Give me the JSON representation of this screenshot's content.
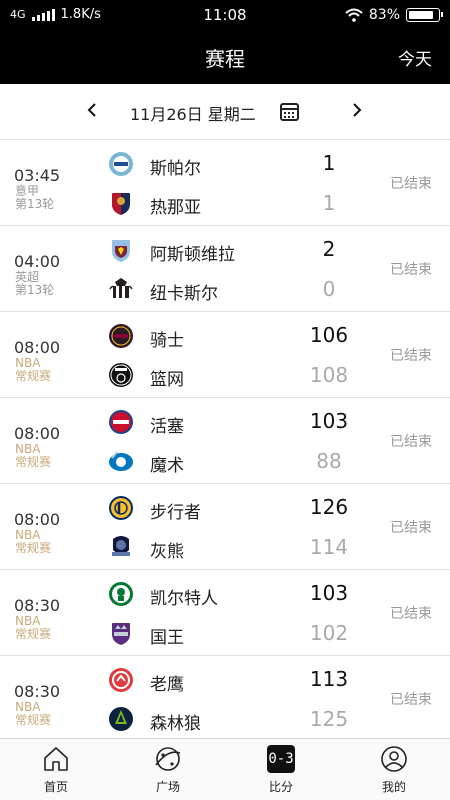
{
  "status": {
    "network": "4G",
    "speed": "1.8K/s",
    "time": "11:08",
    "battery": "83%"
  },
  "header": {
    "title": "赛程",
    "today": "今天"
  },
  "date_bar": {
    "date": "11月26日 星期二"
  },
  "matches": [
    {
      "time": "03:45",
      "league": "意甲",
      "round": "第13轮",
      "home": {
        "name": "斯帕尔",
        "score": "1",
        "logo": "spal-logo",
        "color": "#7ab5d8"
      },
      "away": {
        "name": "热那亚",
        "score": "1",
        "logo": "genoa-logo",
        "color": "#b5162b"
      },
      "status": "已结束"
    },
    {
      "time": "04:00",
      "league": "英超",
      "round": "第13轮",
      "home": {
        "name": "阿斯顿维拉",
        "score": "2",
        "logo": "aston-villa-logo",
        "color": "#95bfe5"
      },
      "away": {
        "name": "纽卡斯尔",
        "score": "0",
        "logo": "newcastle-logo",
        "color": "#241f20"
      },
      "status": "已结束"
    },
    {
      "time": "08:00",
      "league": "NBA",
      "round": "常规赛",
      "home": {
        "name": "骑士",
        "score": "106",
        "logo": "cavaliers-logo",
        "color": "#2b1b22"
      },
      "away": {
        "name": "篮网",
        "score": "108",
        "logo": "nets-logo",
        "color": "#111111"
      },
      "status": "已结束"
    },
    {
      "time": "08:00",
      "league": "NBA",
      "round": "常规赛",
      "home": {
        "name": "活塞",
        "score": "103",
        "logo": "pistons-logo",
        "color": "#c8102e"
      },
      "away": {
        "name": "魔术",
        "score": "88",
        "logo": "magic-logo",
        "color": "#0077c0"
      },
      "status": "已结束"
    },
    {
      "time": "08:00",
      "league": "NBA",
      "round": "常规赛",
      "home": {
        "name": "步行者",
        "score": "126",
        "logo": "pacers-logo",
        "color": "#fdbb30"
      },
      "away": {
        "name": "灰熊",
        "score": "114",
        "logo": "grizzlies-logo",
        "color": "#5d76a9"
      },
      "status": "已结束"
    },
    {
      "time": "08:30",
      "league": "NBA",
      "round": "常规赛",
      "home": {
        "name": "凯尔特人",
        "score": "103",
        "logo": "celtics-logo",
        "color": "#007a33"
      },
      "away": {
        "name": "国王",
        "score": "102",
        "logo": "kings-logo",
        "color": "#5a2d81"
      },
      "status": "已结束"
    },
    {
      "time": "08:30",
      "league": "NBA",
      "round": "常规赛",
      "home": {
        "name": "老鹰",
        "score": "113",
        "logo": "hawks-logo",
        "color": "#e03a3e"
      },
      "away": {
        "name": "森林狼",
        "score": "125",
        "logo": "timberwolves-logo",
        "color": "#0c2340"
      },
      "status": "已结束"
    }
  ],
  "bottom_nav": {
    "home": "首页",
    "plaza": "广场",
    "score": "比分",
    "score_icon": "0-3",
    "mine": "我的"
  }
}
